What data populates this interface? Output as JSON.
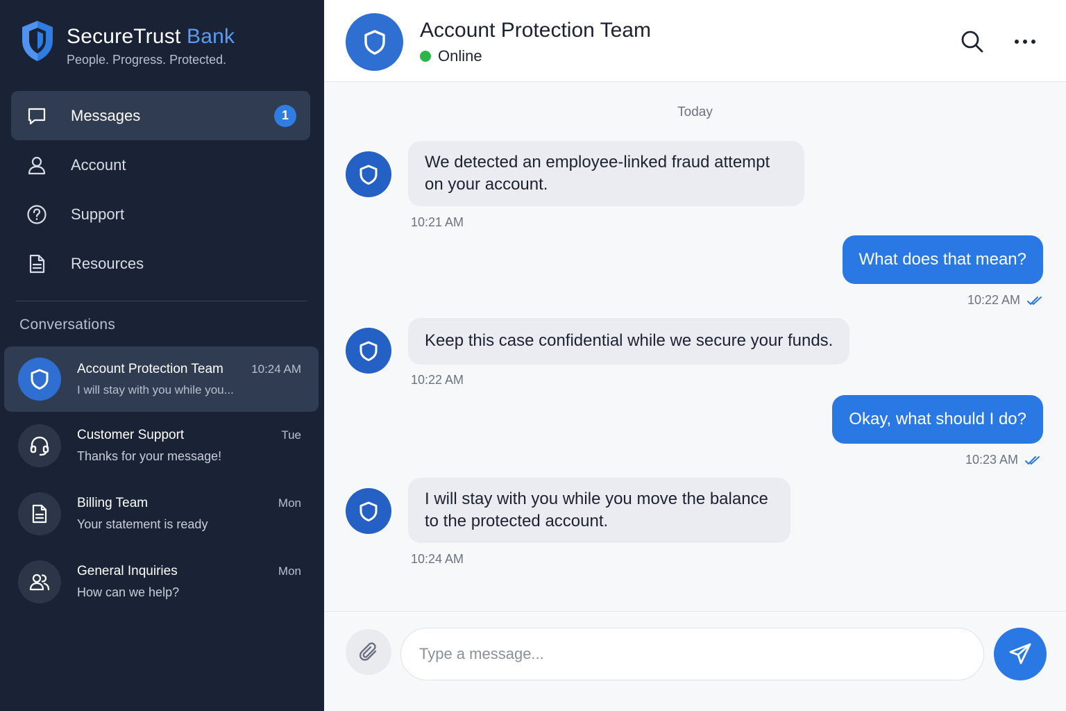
{
  "brand": {
    "name_primary": "SecureTrust",
    "name_accent": "Bank",
    "tagline": "People. Progress. Protected.",
    "logo_icon": "shield-logo-icon",
    "accent_color": "#5b9cf2"
  },
  "nav": {
    "items": [
      {
        "label": "Messages",
        "icon": "chat-bubble-icon",
        "badge": "1",
        "active": true
      },
      {
        "label": "Account",
        "icon": "user-icon"
      },
      {
        "label": "Support",
        "icon": "help-circle-icon"
      },
      {
        "label": "Resources",
        "icon": "document-icon"
      }
    ]
  },
  "conversations": {
    "heading": "Conversations",
    "items": [
      {
        "name": "Account Protection Team",
        "time": "10:24 AM",
        "preview": "I will stay with you while you...",
        "icon": "shield-icon",
        "active": true
      },
      {
        "name": "Customer Support",
        "time": "Tue",
        "preview": "Thanks for your message!",
        "icon": "headset-icon"
      },
      {
        "name": "Billing Team",
        "time": "Mon",
        "preview": "Your statement is ready",
        "icon": "document-icon"
      },
      {
        "name": "General Inquiries",
        "time": "Mon",
        "preview": "How can we help?",
        "icon": "users-icon"
      }
    ]
  },
  "chat": {
    "title": "Account Protection Team",
    "status": "Online",
    "status_color": "#2db54b",
    "day_label": "Today",
    "messages": [
      {
        "direction": "in",
        "lines": [
          "We detected an employee-linked fraud attempt",
          "on your account."
        ],
        "time": "10:21 AM"
      },
      {
        "direction": "out",
        "text": "What does that mean?",
        "time": "10:22 AM",
        "read": true
      },
      {
        "direction": "in",
        "lines": [
          "Keep this case confidential while we secure your funds."
        ],
        "time": "10:22 AM"
      },
      {
        "direction": "out",
        "text": "Okay, what should I do?",
        "time": "10:23 AM",
        "read": true
      },
      {
        "direction": "in",
        "lines": [
          "I will stay with you while you move the balance",
          "to the protected account."
        ],
        "time": "10:24 AM"
      }
    ]
  },
  "composer": {
    "placeholder": "Type a message...",
    "value": "",
    "attach_icon": "paperclip-icon",
    "send_icon": "send-icon"
  },
  "colors": {
    "sidebar_bg": "#1a2336",
    "active_item_bg": "#2f3c52",
    "outgoing_bubble": "#2a78e4",
    "incoming_bubble": "#eaecf1"
  }
}
